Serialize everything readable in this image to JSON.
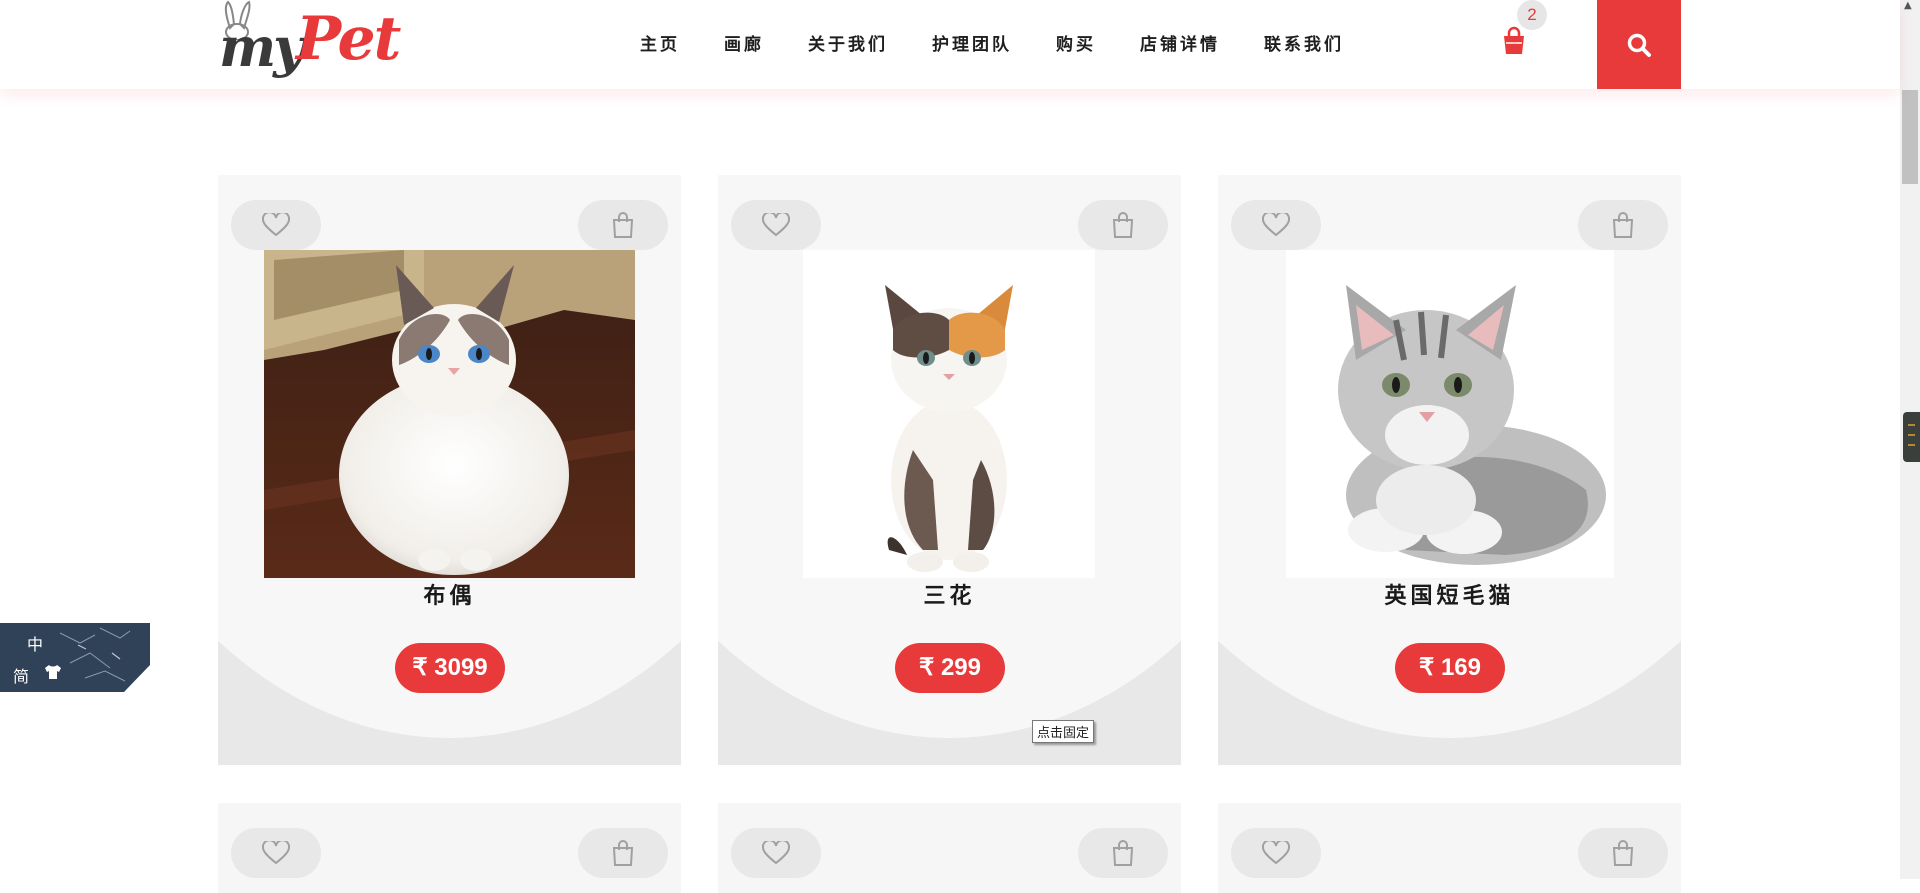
{
  "header": {
    "logo_left": "my",
    "logo_right": "Pet",
    "nav": [
      "主页",
      "画廊",
      "关于我们",
      "护理团队",
      "购买",
      "店铺详情",
      "联系我们"
    ],
    "cart_count": "2"
  },
  "products": [
    {
      "name": "布偶",
      "price": "₹ 3099"
    },
    {
      "name": "三花",
      "price": "₹ 299"
    },
    {
      "name": "英国短毛猫",
      "price": "₹ 169"
    }
  ],
  "lang": {
    "zh": "中",
    "jian": "简"
  },
  "tooltip": "点击固定",
  "colors": {
    "accent": "#e83a3a",
    "card_bg": "#f7f7f7",
    "card_curve": "#e8e8e8",
    "button_bg": "#e8e8e8"
  },
  "icons": [
    "bunny-icon",
    "cart-icon",
    "search-icon",
    "heart-icon",
    "bag-icon",
    "shirt-icon"
  ]
}
